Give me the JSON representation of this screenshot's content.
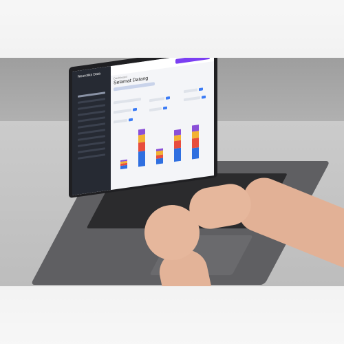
{
  "screen": {
    "sidebar_title": "Neurotiks Data",
    "breadcrumb": "Dashboard",
    "page_title": "Selamat Datang",
    "action_button": "",
    "sidebar_item_count": 11
  },
  "chart_data": {
    "type": "bar",
    "categories": [
      "",
      "",
      "",
      "",
      ""
    ],
    "series": [
      {
        "name": "",
        "values": [
          2,
          8,
          3,
          7,
          6
        ]
      },
      {
        "name": "",
        "values": [
          1,
          5,
          2,
          4,
          5
        ]
      },
      {
        "name": "",
        "values": [
          1,
          4,
          2,
          3,
          4
        ]
      },
      {
        "name": "",
        "values": [
          1,
          3,
          1,
          3,
          3
        ]
      }
    ],
    "colors": [
      "#2f6fe0",
      "#e84d3d",
      "#f2b233",
      "#8a4fd8"
    ]
  }
}
